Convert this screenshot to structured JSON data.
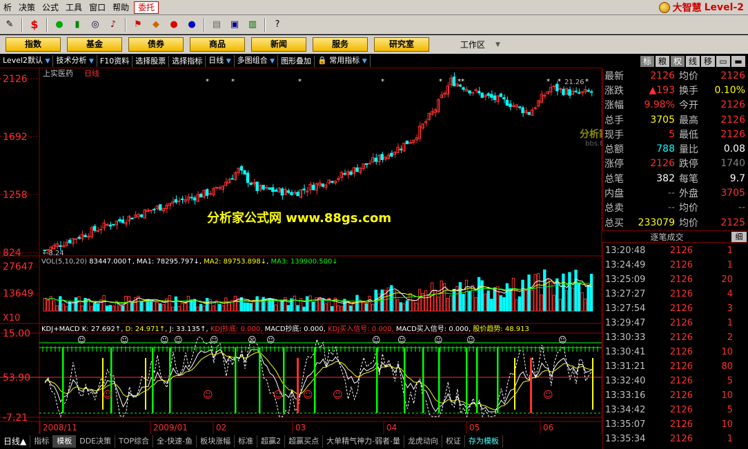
{
  "menu": [
    "析",
    "决策",
    "公式",
    "工具",
    "窗口",
    "帮助",
    "委托"
  ],
  "brand": {
    "name": "大智慧",
    "level": "Level-2"
  },
  "nav": [
    "指数",
    "基金",
    "债券",
    "商品",
    "新闻",
    "服务",
    "研究室"
  ],
  "workspace": "工作区",
  "strip": [
    "Level2默认",
    "技术分析",
    "F10资料",
    "选择股票",
    "选择指标",
    "日线",
    "多图组合",
    "图形叠加",
    "常用指标"
  ],
  "rtabs": [
    "标",
    "粮",
    "权",
    "线",
    "移"
  ],
  "colors": {
    "up": "#ff3030",
    "down": "#00ffff",
    "ma1": "#ffffff",
    "ma2": "#ffff00",
    "ma3": "#00ff00",
    "grid": "#990000"
  },
  "chart_data": [
    {
      "type": "candlestick",
      "title": "上实医药",
      "period": "日线",
      "yticks": [
        "2126",
        "1692",
        "1258",
        "824"
      ],
      "ylim": [
        824,
        2126
      ],
      "low_label": "8.24",
      "high_label": "21.26",
      "watermark": "分析家公式网 www.88gs.com",
      "trend": [
        {
          "i": 0,
          "v": 840
        },
        {
          "i": 20,
          "v": 1030
        },
        {
          "i": 40,
          "v": 1190
        },
        {
          "i": 55,
          "v": 1290
        },
        {
          "i": 62,
          "v": 1440
        },
        {
          "i": 68,
          "v": 1300
        },
        {
          "i": 80,
          "v": 1270
        },
        {
          "i": 95,
          "v": 1400
        },
        {
          "i": 110,
          "v": 1560
        },
        {
          "i": 118,
          "v": 1680
        },
        {
          "i": 125,
          "v": 1900
        },
        {
          "i": 130,
          "v": 2110
        },
        {
          "i": 140,
          "v": 2000
        },
        {
          "i": 148,
          "v": 1950
        },
        {
          "i": 155,
          "v": 1870
        },
        {
          "i": 162,
          "v": 2060
        },
        {
          "i": 170,
          "v": 2010
        },
        {
          "i": 176,
          "v": 2030
        }
      ]
    },
    {
      "type": "bar",
      "title": "VOL(5,10,20)",
      "values_text": "83447.000",
      "ma1": "MA1: 78295.797",
      "ma2": "MA2: 89753.898",
      "ma3": "MA3: 139900.500",
      "yticks": [
        "27647",
        "13649",
        "X10"
      ]
    },
    {
      "type": "line",
      "title": "KDJ+MACD",
      "k": "K: 27.692",
      "d": "D: 24.971",
      "j": "J: 33.135",
      "labels": [
        "KDJ抄底: 0.000",
        "MACD抄底: 0.000",
        "KDJ买入信号: 0.000",
        "MACD买入信号: 0.000",
        "股价趋势: 48.913"
      ],
      "yticks": [
        "15.00",
        "53.90",
        "-7.21"
      ],
      "xticks": [
        "2008/11",
        "2009/01",
        "02",
        "03",
        "04",
        "05",
        "06"
      ]
    }
  ],
  "quote": [
    {
      "k": "最新",
      "v": "2126",
      "c": "up",
      "k2": "均价",
      "v2": "2126",
      "c2": "up"
    },
    {
      "k": "涨跌",
      "v": "▲193",
      "c": "up",
      "k2": "换手",
      "v2": "0.10%",
      "c2": "yel"
    },
    {
      "k": "涨幅",
      "v": "9.98%",
      "c": "up",
      "k2": "今开",
      "v2": "2126",
      "c2": "up"
    },
    {
      "k": "总手",
      "v": "3705",
      "c": "yel",
      "k2": "最高",
      "v2": "2126",
      "c2": "up"
    },
    {
      "k": "现手",
      "v": "5",
      "c": "up",
      "k2": "最低",
      "v2": "2126",
      "c2": "up"
    },
    {
      "k": "总额",
      "v": "788",
      "c": "cyan",
      "k2": "量比",
      "v2": "0.08",
      "c2": "white"
    },
    {
      "k": "涨停",
      "v": "2126",
      "c": "up",
      "k2": "跌停",
      "v2": "1740",
      "c2": "gray"
    },
    {
      "k": "总笔",
      "v": "382",
      "c": "white",
      "k2": "每笔",
      "v2": "9.7",
      "c2": "white"
    },
    {
      "k": "内盘",
      "v": "--",
      "c": "gray",
      "k2": "外盘",
      "v2": "3705",
      "c2": "up"
    },
    {
      "k": "总卖",
      "v": "--",
      "c": "gray",
      "k2": "均价",
      "v2": "--",
      "c2": "gray"
    },
    {
      "k": "总买",
      "v": "233079",
      "c": "yel",
      "k2": "均价",
      "v2": "2125",
      "c2": "up"
    }
  ],
  "ticks_title": "逐笔成交",
  "ticks_detail": "细",
  "ticks": [
    {
      "t": "13:20:48",
      "p": "2126",
      "v": "1"
    },
    {
      "t": "13:24:49",
      "p": "2126",
      "v": "1"
    },
    {
      "t": "13:25:09",
      "p": "2126",
      "v": "20"
    },
    {
      "t": "13:27:27",
      "p": "2126",
      "v": "4"
    },
    {
      "t": "13:27:54",
      "p": "2126",
      "v": "3"
    },
    {
      "t": "13:29:47",
      "p": "2126",
      "v": "1"
    },
    {
      "t": "13:30:33",
      "p": "2126",
      "v": "2"
    },
    {
      "t": "13:30:41",
      "p": "2126",
      "v": "10"
    },
    {
      "t": "13:31:21",
      "p": "2126",
      "v": "80"
    },
    {
      "t": "13:32:40",
      "p": "2126",
      "v": "5"
    },
    {
      "t": "13:33:16",
      "p": "2126",
      "v": "10"
    },
    {
      "t": "13:34:42",
      "p": "2126",
      "v": "5"
    },
    {
      "t": "13:35:07",
      "p": "2126",
      "v": "10"
    },
    {
      "t": "13:35:34",
      "p": "2126",
      "v": "1"
    }
  ],
  "forum_watermark": "分析家论坛",
  "forum_url": "bbs.88gs.com",
  "bottom": [
    "日线▲",
    "指标",
    "模板",
    "DDE决策",
    "TOP综合",
    "全-快速-鱼",
    "板块涨幅",
    "标准",
    "超赢2",
    "超赢买点",
    "大单精气神力-弱者-量",
    "龙虎动向",
    "权证",
    "存为模板"
  ]
}
